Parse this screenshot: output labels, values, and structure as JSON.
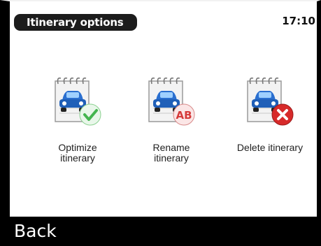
{
  "header": {
    "title": "Itinerary options",
    "time": "17:10"
  },
  "options": [
    {
      "label": "Optimize\nitinerary",
      "icon": "itinerary-optimize-icon",
      "badge": "check"
    },
    {
      "label": "Rename\nitinerary",
      "icon": "itinerary-rename-icon",
      "badge": "AB"
    },
    {
      "label": "Delete itinerary",
      "icon": "itinerary-delete-icon",
      "badge": "cross"
    }
  ],
  "footer": {
    "back_label": "Back"
  },
  "colors": {
    "frame": "#000000",
    "panel": "#ffffff",
    "title_bg": "#1c1c1c",
    "car": "#1f5fb8",
    "check_badge": "#5fc26a",
    "rename_badge": "#d63a3a",
    "delete_badge": "#d72a2a"
  }
}
